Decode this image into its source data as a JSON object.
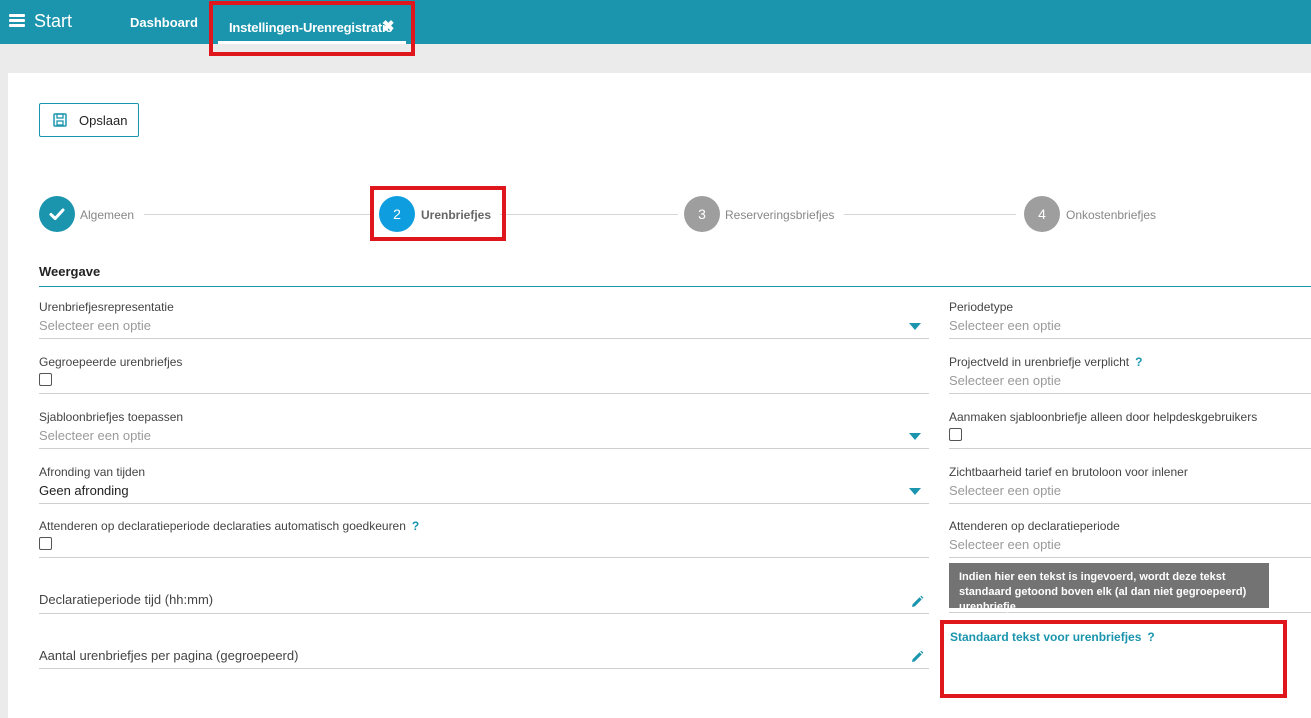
{
  "topbar": {
    "start_label": "Start",
    "dashboard_label": "Dashboard",
    "active_tab_label": "Instellingen-Urenregistratie",
    "close_symbol": "✖"
  },
  "toolbar": {
    "save_label": "Opslaan"
  },
  "stepper": {
    "steps": [
      {
        "number": "",
        "label": "Algemeen",
        "state": "done"
      },
      {
        "number": "2",
        "label": "Urenbriefjes",
        "state": "active"
      },
      {
        "number": "3",
        "label": "Reserveringsbriefjes",
        "state": "pending"
      },
      {
        "number": "4",
        "label": "Onkostenbriefjes",
        "state": "pending"
      }
    ]
  },
  "section": {
    "title": "Weergave"
  },
  "left_fields": {
    "representatie": {
      "label": "Urenbriefjesrepresentatie",
      "value": "Selecteer een optie"
    },
    "gegroepeerd": {
      "label": "Gegroepeerde urenbriefjes"
    },
    "sjabloon": {
      "label": "Sjabloonbriefjes toepassen",
      "value": "Selecteer een optie"
    },
    "afronding": {
      "label": "Afronding van tijden",
      "value": "Geen afronding"
    },
    "attenderen_goedkeuren": {
      "label": "Attenderen op declaratieperiode declaraties automatisch goedkeuren",
      "help": "?"
    },
    "declaratie_tijd": {
      "label": "Declaratieperiode tijd (hh:mm)"
    },
    "aantal_per_pagina": {
      "label": "Aantal urenbriefjes per pagina (gegroepeerd)"
    }
  },
  "right_fields": {
    "periodetype": {
      "label": "Periodetype",
      "value": "Selecteer een optie"
    },
    "projectveld": {
      "label": "Projectveld in urenbriefje verplicht",
      "help": "?",
      "value": "Selecteer een optie"
    },
    "aanmaken_sjabloon": {
      "label": "Aanmaken sjabloonbriefje alleen door helpdeskgebruikers"
    },
    "zichtbaarheid": {
      "label": "Zichtbaarheid tarief en brutoloon voor inlener",
      "value": "Selecteer een optie"
    },
    "attenderen": {
      "label": "Attenderen op declaratieperiode",
      "value": "Selecteer een optie"
    },
    "standaard_tekst": {
      "label": "Standaard tekst voor urenbriefjes",
      "help": "?"
    }
  },
  "tooltip": {
    "text": "Indien hier een tekst is ingevoerd, wordt deze tekst standaard getoond boven elk (al dan niet gegroepeerd) urenbriefje."
  },
  "colors": {
    "brand": "#1a95ad",
    "active_step": "#0e9ee0",
    "pending_step": "#9e9e9e",
    "highlight": "#e0161d"
  }
}
